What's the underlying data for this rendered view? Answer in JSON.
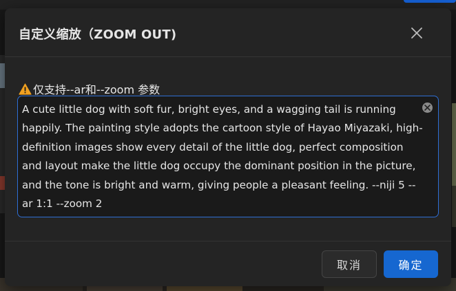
{
  "dialog": {
    "title": "自定义缩放（ZOOM OUT)",
    "close_icon": "close-icon"
  },
  "notice": {
    "icon": "warning-icon",
    "text": "仅支持--ar和--zoom 参数"
  },
  "prompt": {
    "value": "A cute little dog with soft fur, bright eyes, and a wagging tail is running happily. The painting style adopts the cartoon style of Hayao Miyazaki, high-definition images show every detail of the little dog, perfect composition and layout make the little dog occupy the dominant position in the picture, and the tone is bright and warm, giving people a pleasant feeling. --niji 5 --ar 1:1 --zoom 2",
    "clear_icon": "clear-circle-icon"
  },
  "footer": {
    "cancel_label": "取消",
    "confirm_label": "确定"
  },
  "colors": {
    "accent": "#1667d0",
    "focus_border": "#2f6fd6",
    "warning": "#f0a020",
    "modal_bg": "#242424"
  }
}
